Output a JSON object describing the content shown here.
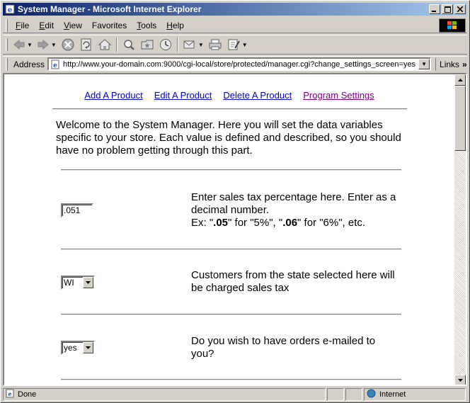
{
  "window": {
    "title": "System Manager - Microsoft Internet Explorer"
  },
  "menu": {
    "items": [
      {
        "accel": "F",
        "rest": "ile"
      },
      {
        "accel": "E",
        "rest": "dit"
      },
      {
        "accel": "V",
        "rest": "iew"
      },
      {
        "accel": "",
        "rest": "Favorites"
      },
      {
        "accel": "T",
        "rest": "ools"
      },
      {
        "accel": "H",
        "rest": "elp"
      }
    ]
  },
  "address": {
    "label": "Address",
    "url": "http://www.your-domain.com:9000/cgi-local/store/protected/manager.cgi?change_settings_screen=yes",
    "links_label": "Links"
  },
  "nav": {
    "add_product": "Add A Product",
    "edit_product": "Edit A Product",
    "delete_product": "Delete A Product",
    "program_settings": "Program Settings"
  },
  "welcome_text": "Welcome to the System Manager. Here you will set the data variables specific to your store. Each value is defined and described, so you should have no problem getting through this part.",
  "settings": {
    "sales_tax": {
      "value": ".051",
      "desc_line": "Enter sales tax percentage here. Enter as a decimal number.",
      "ex_prefix": "Ex: \"",
      "ex_a_bold": ".05",
      "ex_a_rest": "\" for \"5%\", \"",
      "ex_b_bold": ".06",
      "ex_b_rest": "\" for \"6%\", etc."
    },
    "tax_state": {
      "value": "WI",
      "desc": "Customers from the state selected here will be charged sales tax"
    },
    "email_orders": {
      "value": "yes",
      "desc": "Do you wish to have orders e-mailed to you?"
    }
  },
  "status": {
    "text": "Done",
    "zone": "Internet"
  },
  "colors": {
    "titlebar_start": "#0a246a",
    "titlebar_end": "#a6caf0",
    "link": "#0000cc",
    "visited_link": "#800080"
  }
}
